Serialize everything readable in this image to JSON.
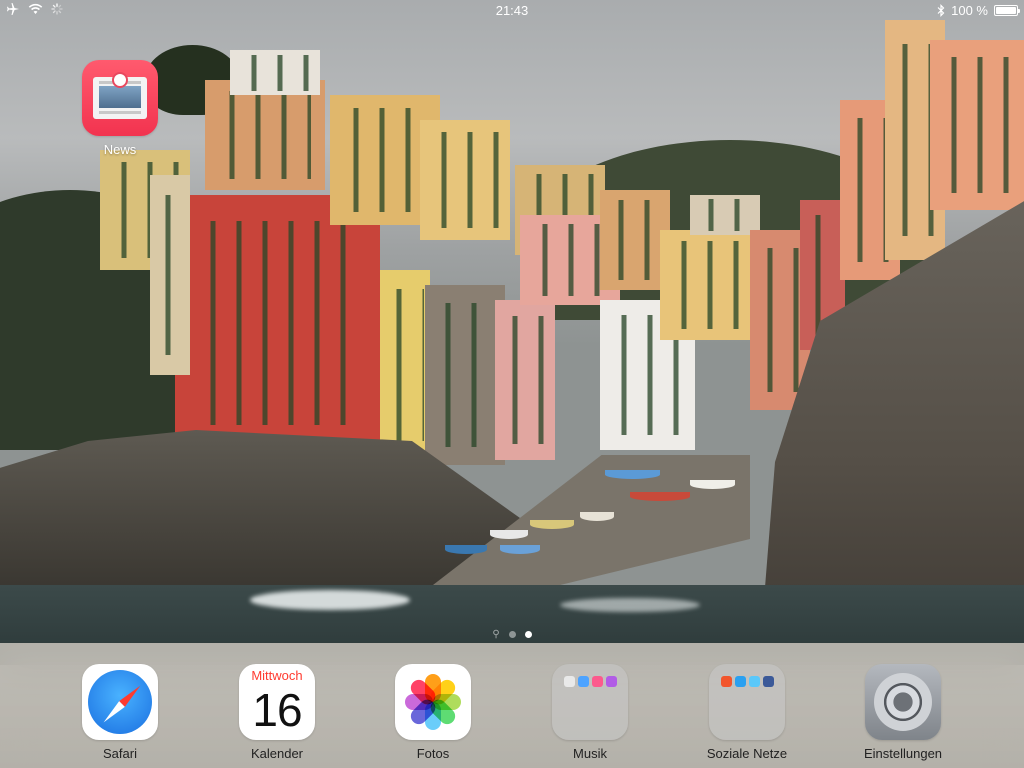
{
  "status_bar": {
    "time": "21:43",
    "battery_percent": "100 %",
    "icons": [
      "airplane-icon",
      "wifi-icon",
      "activity-icon",
      "bluetooth-icon",
      "battery-icon"
    ]
  },
  "home_screen": {
    "apps": [
      {
        "label": "News",
        "icon": "news-icon"
      }
    ],
    "page_indicator": {
      "pages": 2,
      "current_page": 2,
      "has_search_page": true
    }
  },
  "dock": {
    "apps": [
      {
        "label": "Safari",
        "icon": "safari-icon"
      },
      {
        "label": "Kalender",
        "icon": "calendar-icon",
        "weekday": "Mittwoch",
        "date": "16"
      },
      {
        "label": "Fotos",
        "icon": "photos-icon"
      },
      {
        "label": "Musik",
        "icon": "folder-icon",
        "type": "folder"
      },
      {
        "label": "Soziale Netze",
        "icon": "folder-icon",
        "type": "folder"
      },
      {
        "label": "Einstellungen",
        "icon": "settings-icon"
      }
    ]
  },
  "colors": {
    "calendar_weekday": "#ff3b30",
    "news_icon": "#f2334f",
    "dock_label": "#222222"
  }
}
